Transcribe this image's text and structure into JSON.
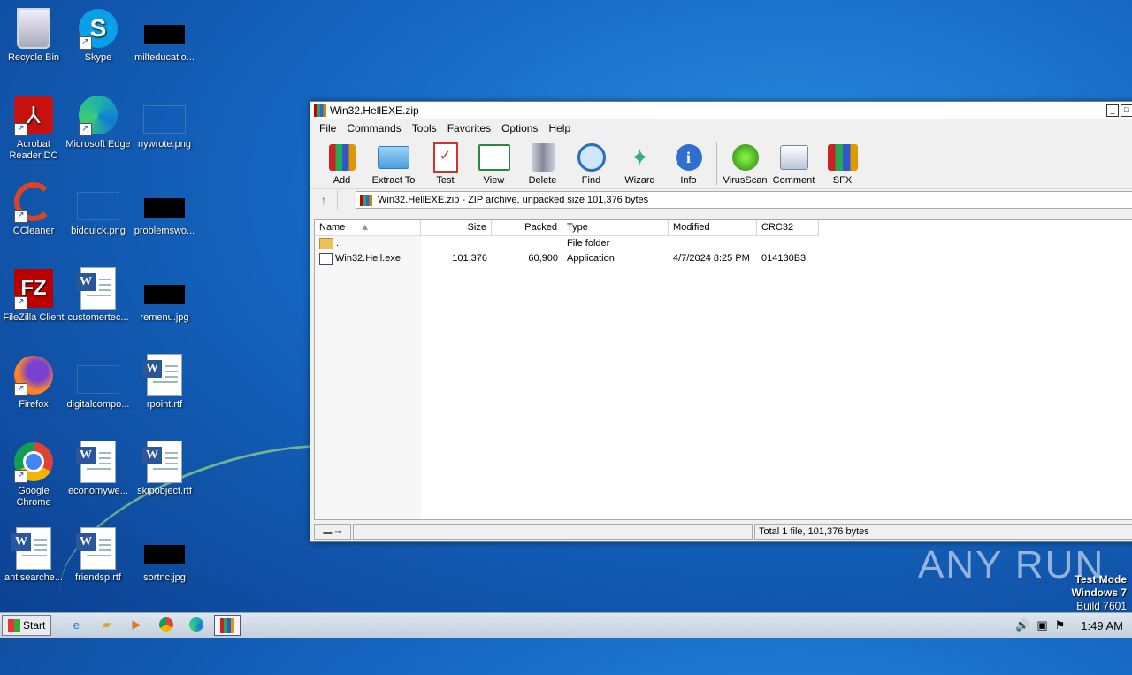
{
  "desktop": {
    "icons": [
      {
        "label": "Recycle Bin"
      },
      {
        "label": "Skype"
      },
      {
        "label": "milfeducatio..."
      },
      {
        "label": "Acrobat Reader DC"
      },
      {
        "label": "Microsoft Edge"
      },
      {
        "label": "nywrote.png"
      },
      {
        "label": "CCleaner"
      },
      {
        "label": "bidquick.png"
      },
      {
        "label": "problemswo..."
      },
      {
        "label": "FileZilla Client"
      },
      {
        "label": "customertec..."
      },
      {
        "label": "remenu.jpg"
      },
      {
        "label": "Firefox"
      },
      {
        "label": "digitalcompo..."
      },
      {
        "label": "rpoint.rtf"
      },
      {
        "label": "Google Chrome"
      },
      {
        "label": "economywe..."
      },
      {
        "label": "skipobject.rtf"
      },
      {
        "label": "antisearche..."
      },
      {
        "label": "friendsp.rtf"
      },
      {
        "label": "sortnc.jpg"
      }
    ]
  },
  "window": {
    "title": "Win32.HellEXE.zip",
    "menu": [
      "File",
      "Commands",
      "Tools",
      "Favorites",
      "Options",
      "Help"
    ],
    "toolbar": [
      "Add",
      "Extract To",
      "Test",
      "View",
      "Delete",
      "Find",
      "Wizard",
      "Info",
      "VirusScan",
      "Comment",
      "SFX"
    ],
    "address": "Win32.HellEXE.zip - ZIP archive, unpacked size 101,376 bytes",
    "columns": [
      "Name",
      "Size",
      "Packed",
      "Type",
      "Modified",
      "CRC32"
    ],
    "rows": [
      {
        "name": "..",
        "size": "",
        "packed": "",
        "type": "File folder",
        "modified": "",
        "crc": ""
      },
      {
        "name": "Win32.Hell.exe",
        "size": "101,376",
        "packed": "60,900",
        "type": "Application",
        "modified": "4/7/2024 8:25 PM",
        "crc": "014130B3"
      }
    ],
    "status": "Total 1 file, 101,376 bytes"
  },
  "watermark": {
    "brand": "ANY RUN",
    "line1": "Test Mode",
    "line2": "Windows 7",
    "line3": "Build 7601"
  },
  "taskbar": {
    "start": "Start",
    "clock": "1:49 AM"
  }
}
